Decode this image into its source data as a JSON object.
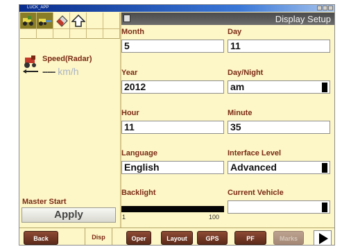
{
  "window": {
    "app_title": "LUCK_APP"
  },
  "pane": {
    "title": "Display Setup"
  },
  "speed": {
    "label": "Speed(Radar)",
    "value": "-----",
    "unit": "km/h"
  },
  "master": {
    "label": "Master Start",
    "apply_label": "Apply"
  },
  "fields": {
    "month": {
      "label": "Month",
      "value": "5"
    },
    "day": {
      "label": "Day",
      "value": "11"
    },
    "year": {
      "label": "Year",
      "value": "2012"
    },
    "day_night": {
      "label": "Day/Night",
      "value": "am"
    },
    "hour": {
      "label": "Hour",
      "value": "11"
    },
    "minute": {
      "label": "Minute",
      "value": "35"
    },
    "language": {
      "label": "Language",
      "value": "English"
    },
    "interface_level": {
      "label": "Interface Level",
      "value": "Advanced"
    },
    "backlight": {
      "label": "Backlight",
      "min": "1",
      "max": "100",
      "level_fraction": 1.0
    },
    "current_vehicle": {
      "label": "Current Vehicle",
      "value": ""
    }
  },
  "tabs": {
    "back": "Back",
    "disp": "Disp",
    "oper": "Oper",
    "layout": "Layout",
    "gps": "GPS",
    "pf": "PF",
    "marks": "Marks"
  },
  "colors": {
    "label": "#7a2a14",
    "background": "#fdf6c6",
    "tab": "#6e3422"
  },
  "icons": [
    "tractor-icon",
    "tractor-implement-icon",
    "eraser-icon",
    "home-arrow-icon",
    "speed-radar-icon",
    "next-arrow-icon"
  ]
}
